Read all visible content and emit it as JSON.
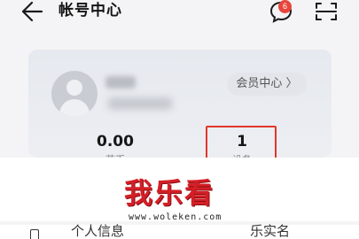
{
  "header": {
    "title": "帐号中心",
    "message_badge": "6",
    "back_icon": "arrow-left-icon",
    "message_icon": "message-bubble-icon",
    "scan_icon": "scan-icon"
  },
  "profile": {
    "avatar_icon": "default-avatar-icon",
    "vip_label": "会员中心 〉"
  },
  "stats": [
    {
      "value": "0.00",
      "label": "花币"
    },
    {
      "value": "1",
      "label": "设备"
    }
  ],
  "watermark": {
    "logo": "我乐看",
    "url": "www.woleken.com"
  },
  "menu": {
    "partial_item_1": "个人信息",
    "partial_item_2": "乐实名"
  },
  "colors": {
    "accent_red": "#e2362b",
    "badge_red": "#e8463c",
    "logo_red": "#d41f26"
  }
}
